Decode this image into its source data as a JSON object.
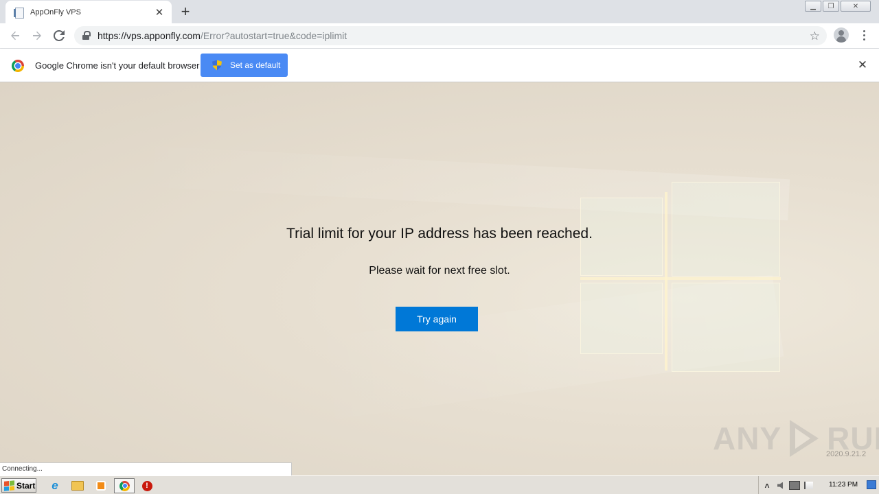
{
  "browser": {
    "tab_title": "AppOnFly VPS",
    "tab_close_glyph": "✕",
    "new_tab_glyph": "+",
    "window_controls": {
      "minimize": "▁",
      "restore": "❐",
      "close": "✕"
    },
    "url_host": "https://vps.apponfly.com",
    "url_path": "/Error?autostart=true&code=iplimit",
    "icons": [
      "back-arrow-icon",
      "forward-arrow-icon",
      "reload-icon",
      "lock-icon",
      "star-icon",
      "profile-icon",
      "menu-icon"
    ]
  },
  "infobar": {
    "message": "Google Chrome isn't your default browser",
    "button_label": "Set as default",
    "close_glyph": "✕"
  },
  "page": {
    "title": "Trial limit for your IP address has been reached.",
    "subtitle": "Please wait for next free slot.",
    "button_label": "Try again",
    "button_color": "#0078d7"
  },
  "watermark": {
    "left_text": "ANY",
    "right_text": "RUN",
    "version": "2020.9.21.2"
  },
  "status_text": "Connecting...",
  "taskbar": {
    "start_label": "Start",
    "pinned": [
      "internet-explorer-icon",
      "file-explorer-icon",
      "media-player-icon",
      "chrome-icon",
      "stop-icon"
    ],
    "tray_up_glyph": "˄",
    "clock": "11:23 PM"
  }
}
